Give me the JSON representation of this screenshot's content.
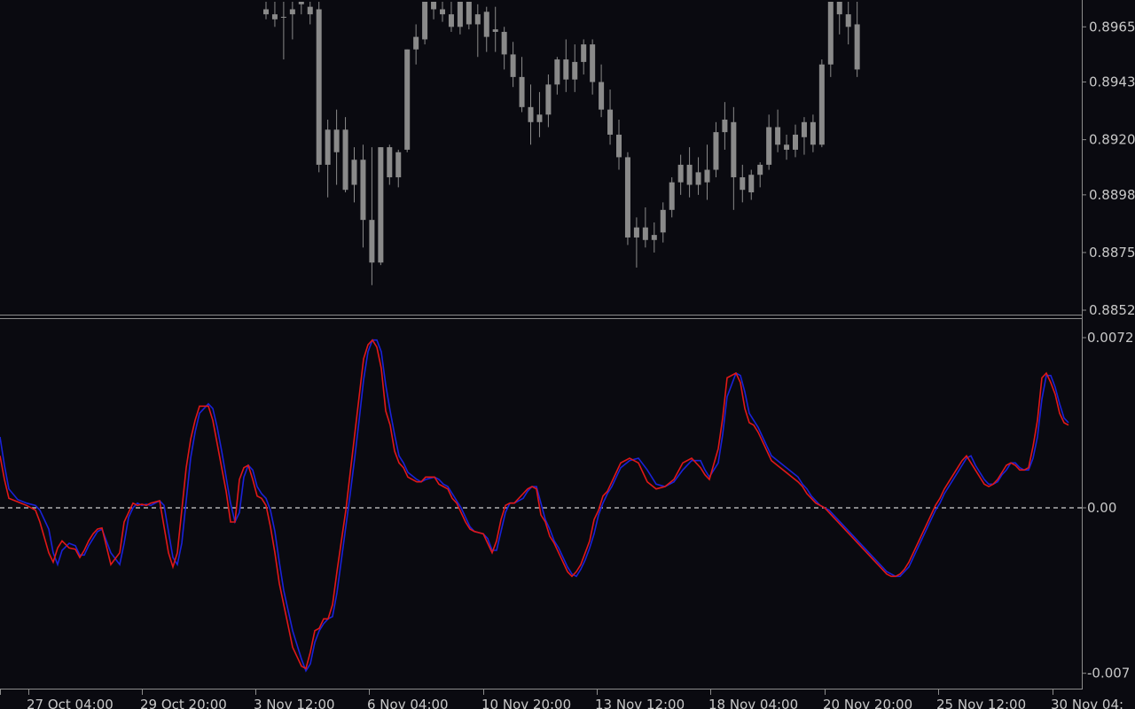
{
  "colors": {
    "background": "#0a0a10",
    "axis": "#8c8c8c",
    "candle": "#8a8a8a",
    "main_line": "#e01818",
    "signal_line": "#1a22d8",
    "zero_line": "#d0d0d0"
  },
  "chart_data": [
    {
      "type": "candlestick",
      "panel": "price",
      "ylim": [
        0.8852,
        0.8975
      ],
      "y_ticks": [
        "0.8965",
        "0.8943",
        "0.8920",
        "0.8898",
        "0.8875",
        "0.8852"
      ],
      "x_tick_labels": [
        "0",
        "27 Oct 04:00",
        "29 Oct 20:00",
        "3 Nov 12:00",
        "6 Nov 04:00",
        "10 Nov 20:00",
        "13 Nov 12:00",
        "18 Nov 04:00",
        "20 Nov 20:00",
        "25 Nov 12:00",
        "30 Nov 04:"
      ],
      "candles": [
        [
          0.8972,
          0.8975,
          0.8968,
          0.897
        ],
        [
          0.897,
          0.8975,
          0.8965,
          0.8968
        ],
        [
          0.8969,
          0.8975,
          0.8952,
          0.8969
        ],
        [
          0.897,
          0.8975,
          0.896,
          0.8972
        ],
        [
          0.8974,
          0.8975,
          0.897,
          0.8975
        ],
        [
          0.897,
          0.8975,
          0.8966,
          0.8973
        ],
        [
          0.8972,
          0.8975,
          0.8907,
          0.891
        ],
        [
          0.891,
          0.8928,
          0.8897,
          0.8924
        ],
        [
          0.8915,
          0.8932,
          0.8902,
          0.8924
        ],
        [
          0.8924,
          0.8929,
          0.8899,
          0.89
        ],
        [
          0.8902,
          0.8917,
          0.8895,
          0.8912
        ],
        [
          0.8912,
          0.8918,
          0.8877,
          0.8888
        ],
        [
          0.8888,
          0.8917,
          0.8862,
          0.8871
        ],
        [
          0.8871,
          0.8917,
          0.887,
          0.8917
        ],
        [
          0.8917,
          0.8918,
          0.8902,
          0.8905
        ],
        [
          0.8905,
          0.8916,
          0.8901,
          0.8915
        ],
        [
          0.8916,
          0.8956,
          0.8915,
          0.8956
        ],
        [
          0.8956,
          0.8966,
          0.895,
          0.8961
        ],
        [
          0.896,
          0.8975,
          0.8958,
          0.8975
        ],
        [
          0.8975,
          0.8975,
          0.8968,
          0.8972
        ],
        [
          0.8972,
          0.8975,
          0.8967,
          0.897
        ],
        [
          0.897,
          0.8975,
          0.8963,
          0.8965
        ],
        [
          0.8965,
          0.8975,
          0.8962,
          0.8975
        ],
        [
          0.8975,
          0.8975,
          0.8964,
          0.8966
        ],
        [
          0.8966,
          0.8974,
          0.8953,
          0.897
        ],
        [
          0.8971,
          0.8973,
          0.8955,
          0.8961
        ],
        [
          0.8964,
          0.8973,
          0.8955,
          0.8963
        ],
        [
          0.8963,
          0.8965,
          0.8948,
          0.8954
        ],
        [
          0.8954,
          0.8959,
          0.8941,
          0.8945
        ],
        [
          0.8945,
          0.8953,
          0.8931,
          0.8933
        ],
        [
          0.8933,
          0.8942,
          0.8918,
          0.8927
        ],
        [
          0.8927,
          0.8939,
          0.8921,
          0.893
        ],
        [
          0.893,
          0.8946,
          0.8925,
          0.8942
        ],
        [
          0.8942,
          0.8953,
          0.8938,
          0.8952
        ],
        [
          0.8952,
          0.896,
          0.8939,
          0.8944
        ],
        [
          0.8944,
          0.8958,
          0.8939,
          0.8951
        ],
        [
          0.8951,
          0.896,
          0.8946,
          0.8958
        ],
        [
          0.8958,
          0.896,
          0.8938,
          0.8943
        ],
        [
          0.8943,
          0.895,
          0.8929,
          0.8932
        ],
        [
          0.8932,
          0.894,
          0.8918,
          0.8922
        ],
        [
          0.8922,
          0.8928,
          0.8908,
          0.8913
        ],
        [
          0.8913,
          0.8915,
          0.8878,
          0.8881
        ],
        [
          0.8881,
          0.8889,
          0.8869,
          0.8885
        ],
        [
          0.8885,
          0.8893,
          0.8877,
          0.888
        ],
        [
          0.888,
          0.8887,
          0.8875,
          0.8882
        ],
        [
          0.8883,
          0.8895,
          0.8879,
          0.8892
        ],
        [
          0.8892,
          0.8905,
          0.8889,
          0.8903
        ],
        [
          0.8903,
          0.8914,
          0.8898,
          0.891
        ],
        [
          0.891,
          0.8917,
          0.8897,
          0.8902
        ],
        [
          0.8902,
          0.8913,
          0.8898,
          0.8907
        ],
        [
          0.8903,
          0.8918,
          0.8896,
          0.8908
        ],
        [
          0.8908,
          0.8927,
          0.8905,
          0.8923
        ],
        [
          0.8923,
          0.8935,
          0.8916,
          0.8928
        ],
        [
          0.8927,
          0.8933,
          0.8892,
          0.8905
        ],
        [
          0.8905,
          0.891,
          0.8895,
          0.89
        ],
        [
          0.8899,
          0.8908,
          0.8896,
          0.8906
        ],
        [
          0.8906,
          0.8911,
          0.8901,
          0.891
        ],
        [
          0.891,
          0.893,
          0.8908,
          0.8925
        ],
        [
          0.8925,
          0.8932,
          0.8915,
          0.8918
        ],
        [
          0.8918,
          0.8922,
          0.8912,
          0.8916
        ],
        [
          0.8916,
          0.8926,
          0.8913,
          0.8922
        ],
        [
          0.8921,
          0.8929,
          0.8914,
          0.8927
        ],
        [
          0.8927,
          0.893,
          0.8915,
          0.8918
        ],
        [
          0.8918,
          0.8952,
          0.8917,
          0.895
        ],
        [
          0.895,
          0.8975,
          0.8945,
          0.8975
        ],
        [
          0.8975,
          0.8975,
          0.8962,
          0.897
        ],
        [
          0.897,
          0.8975,
          0.8958,
          0.8965
        ],
        [
          0.8966,
          0.8975,
          0.8945,
          0.8948
        ]
      ]
    },
    {
      "type": "line",
      "panel": "oscillator",
      "ylim": [
        -0.0075,
        0.0075
      ],
      "y_ticks": [
        "0.0072",
        "0.00",
        "-0.007"
      ],
      "zero_line": 0,
      "x": [
        0,
        5,
        10,
        20,
        30,
        40,
        45,
        55,
        60,
        65,
        70,
        78,
        85,
        90,
        95,
        100,
        105,
        110,
        115,
        125,
        135,
        140,
        145,
        150,
        155,
        160,
        165,
        170,
        180,
        185,
        190,
        195,
        200,
        205,
        210,
        215,
        220,
        225,
        235,
        240,
        245,
        250,
        255,
        260,
        265,
        270,
        275,
        280,
        285,
        290,
        295,
        300,
        305,
        310,
        315,
        320,
        330,
        340,
        345,
        350,
        355,
        360,
        365,
        370,
        375,
        380,
        385,
        390,
        395,
        400,
        405,
        410,
        415,
        420,
        425,
        430,
        435,
        440,
        445,
        450,
        455,
        460,
        470,
        475,
        480,
        490,
        495,
        500,
        505,
        510,
        515,
        520,
        525,
        530,
        535,
        540,
        545,
        550,
        555,
        560,
        565,
        570,
        575,
        580,
        590,
        595,
        600,
        605,
        610,
        615,
        620,
        625,
        630,
        635,
        640,
        645,
        650,
        655,
        660,
        665,
        670,
        675,
        680,
        685,
        690,
        695,
        700,
        710,
        720,
        730,
        740,
        750,
        760,
        770,
        780,
        790,
        795,
        800,
        810,
        815,
        820,
        830,
        835,
        840,
        845,
        850,
        855,
        860,
        865,
        870,
        880,
        890,
        900,
        905,
        910,
        915,
        920,
        925,
        930,
        935,
        940,
        945,
        950,
        955,
        960,
        965,
        970,
        975,
        980,
        985,
        990,
        995,
        1000,
        1005,
        1010,
        1015,
        1020,
        1025,
        1030,
        1035,
        1040,
        1045,
        1050,
        1055,
        1060,
        1065,
        1070,
        1075,
        1080,
        1085,
        1090,
        1095,
        1100,
        1105,
        1110,
        1115,
        1120,
        1125,
        1130,
        1135,
        1140,
        1145,
        1150,
        1155,
        1160,
        1165,
        1170,
        1175,
        1180,
        1185,
        1190,
        1195,
        1200,
        1205,
        1210,
        1212
      ],
      "series": [
        {
          "values": [
            0.0022,
            0.0012,
            0.0004,
            0.00025,
            0.0001,
            -0.0001,
            -0.0006,
            -0.0019,
            -0.0023,
            -0.0017,
            -0.0014,
            -0.0017,
            -0.00175,
            -0.0021,
            -0.0018,
            -0.0014,
            -0.0011,
            -0.0009,
            -0.00085,
            -0.0024,
            -0.0019,
            -0.0006,
            -0.0002,
            0.0002,
            0.0001,
            0.00015,
            0.0001,
            0.0002,
            0.0003,
            -0.0008,
            -0.0019,
            -0.0025,
            -0.0019,
            -0.0001,
            0.0017,
            0.0029,
            0.0037,
            0.0043,
            0.0043,
            0.0037,
            0.0027,
            0.0017,
            0.0007,
            -0.0006,
            -0.0006,
            0.0012,
            0.0017,
            0.0018,
            0.0012,
            0.0005,
            0.0004,
            0.0001,
            -0.0008,
            -0.0019,
            -0.0032,
            -0.0041,
            -0.0059,
            -0.0067,
            -0.0068,
            -0.0061,
            -0.0052,
            -0.0051,
            -0.0047,
            -0.0047,
            -0.0041,
            -0.0027,
            -0.0014,
            -0.0001,
            0.0015,
            0.0031,
            0.0047,
            0.0063,
            0.0069,
            0.0071,
            0.0068,
            0.0059,
            0.0041,
            0.0035,
            0.0024,
            0.0019,
            0.0017,
            0.0013,
            0.0011,
            0.0011,
            0.0013,
            0.0013,
            0.001,
            0.0009,
            0.0008,
            0.0004,
            0.0002,
            -0.0002,
            -0.0006,
            -0.0009,
            -0.001,
            -0.00105,
            -0.0011,
            -0.0015,
            -0.0019,
            -0.0014,
            -0.0005,
            0.0001,
            0.0002,
            0.0002,
            0.0006,
            0.0008,
            0.0009,
            0.0008,
            -0.0003,
            -0.0006,
            -0.0012,
            -0.0015,
            -0.0019,
            -0.0023,
            -0.0027,
            -0.0029,
            -0.0027,
            -0.0024,
            -0.0019,
            -0.0014,
            -0.0005,
            -0.0001,
            0.0005,
            0.0007,
            0.0011,
            0.0015,
            0.0019,
            0.0021,
            0.0019,
            0.0011,
            0.0008,
            0.0009,
            0.0012,
            0.0019,
            0.0021,
            0.0017,
            0.0014,
            0.0012,
            0.0025,
            0.0038,
            0.0055,
            0.0057,
            0.0053,
            0.0042,
            0.0036,
            0.0035,
            0.0032,
            0.0028,
            0.0024,
            0.002,
            0.0017,
            0.0014,
            0.0011,
            0.0009,
            0.0006,
            0.0004,
            0.0002,
            0.0001,
            0.0,
            -0.0002,
            -0.0004,
            -0.0006,
            -0.0008,
            -0.001,
            -0.0012,
            -0.0014,
            -0.0016,
            -0.0018,
            -0.002,
            -0.0022,
            -0.0024,
            -0.0026,
            -0.0028,
            -0.0029,
            -0.0029,
            -0.0028,
            -0.0026,
            -0.0023,
            -0.0019,
            -0.0015,
            -0.0011,
            -0.0007,
            -0.0003,
            0.0001,
            0.0004,
            0.0008,
            0.0011,
            0.0014,
            0.0017,
            0.002,
            0.0022,
            0.0019,
            0.0016,
            0.0013,
            0.001,
            0.0009,
            0.001,
            0.0012,
            0.0015,
            0.0018,
            0.0019,
            0.0018,
            0.0016,
            0.0016,
            0.0017,
            0.0026,
            0.0037,
            0.0055,
            0.0057,
            0.0053,
            0.0048,
            0.004,
            0.0036,
            0.0035
          ],
          "color": "#e01818"
        },
        {
          "values": [
            0.003,
            0.0018,
            0.0008,
            0.00035,
            0.0002,
            0.0001,
            -0.0001,
            -0.0009,
            -0.0019,
            -0.0024,
            -0.0018,
            -0.0015,
            -0.0016,
            -0.002,
            -0.002,
            -0.0016,
            -0.0013,
            -0.001,
            -0.0009,
            -0.0019,
            -0.0024,
            -0.0015,
            -0.0004,
            0.0,
            0.0002,
            0.0001,
            0.00015,
            0.0001,
            0.0003,
            0.0001,
            -0.001,
            -0.0021,
            -0.0024,
            -0.0015,
            0.0003,
            0.0021,
            0.0032,
            0.004,
            0.0044,
            0.0042,
            0.0034,
            0.0024,
            0.0013,
            0.0002,
            -0.0006,
            -0.0002,
            0.0013,
            0.0018,
            0.0016,
            0.0009,
            0.0006,
            0.0004,
            -0.0001,
            -0.001,
            -0.0023,
            -0.0035,
            -0.0052,
            -0.0064,
            -0.0069,
            -0.0066,
            -0.0057,
            -0.0052,
            -0.0049,
            -0.0047,
            -0.0046,
            -0.0036,
            -0.0022,
            -0.0008,
            0.0006,
            0.0021,
            0.0037,
            0.0054,
            0.0066,
            0.0071,
            0.0071,
            0.0066,
            0.0052,
            0.0041,
            0.0031,
            0.0022,
            0.0019,
            0.0015,
            0.0012,
            0.0011,
            0.0012,
            0.0013,
            0.0012,
            0.001,
            0.0009,
            0.0006,
            0.0003,
            0.0,
            -0.0004,
            -0.0008,
            -0.001,
            -0.00105,
            -0.0011,
            -0.0013,
            -0.0018,
            -0.0018,
            -0.001,
            -0.0002,
            0.0002,
            0.0002,
            0.0004,
            0.0007,
            0.0009,
            0.0009,
            0.0002,
            -0.0005,
            -0.0009,
            -0.0014,
            -0.0017,
            -0.0021,
            -0.0025,
            -0.0028,
            -0.0029,
            -0.0026,
            -0.0022,
            -0.0017,
            -0.0011,
            -0.0003,
            0.0002,
            0.0006,
            0.0009,
            0.0013,
            0.0017,
            0.002,
            0.0021,
            0.0016,
            0.001,
            0.0009,
            0.0011,
            0.0016,
            0.002,
            0.002,
            0.0016,
            0.0013,
            0.0019,
            0.0031,
            0.0047,
            0.0057,
            0.0056,
            0.0049,
            0.004,
            0.0037,
            0.0034,
            0.003,
            0.0026,
            0.0022,
            0.0019,
            0.0016,
            0.0013,
            0.001,
            0.0008,
            0.0005,
            0.0003,
            0.0001,
            0.0,
            -0.0001,
            -0.0003,
            -0.0005,
            -0.0007,
            -0.0009,
            -0.0011,
            -0.0013,
            -0.0015,
            -0.0017,
            -0.0019,
            -0.0021,
            -0.0023,
            -0.0025,
            -0.0027,
            -0.0028,
            -0.0029,
            -0.0029,
            -0.0027,
            -0.0025,
            -0.0021,
            -0.0017,
            -0.0013,
            -0.0009,
            -0.0005,
            -0.0001,
            0.0002,
            0.0006,
            0.0009,
            0.0012,
            0.0015,
            0.0018,
            0.0021,
            0.0022,
            0.0018,
            0.0015,
            0.0012,
            0.001,
            0.001,
            0.0011,
            0.0014,
            0.0016,
            0.0019,
            0.0019,
            0.0017,
            0.0016,
            0.0016,
            0.0021,
            0.003,
            0.0046,
            0.0056,
            0.0056,
            0.0051,
            0.0044,
            0.0038,
            0.0036
          ],
          "color": "#1a22d8"
        }
      ]
    }
  ]
}
